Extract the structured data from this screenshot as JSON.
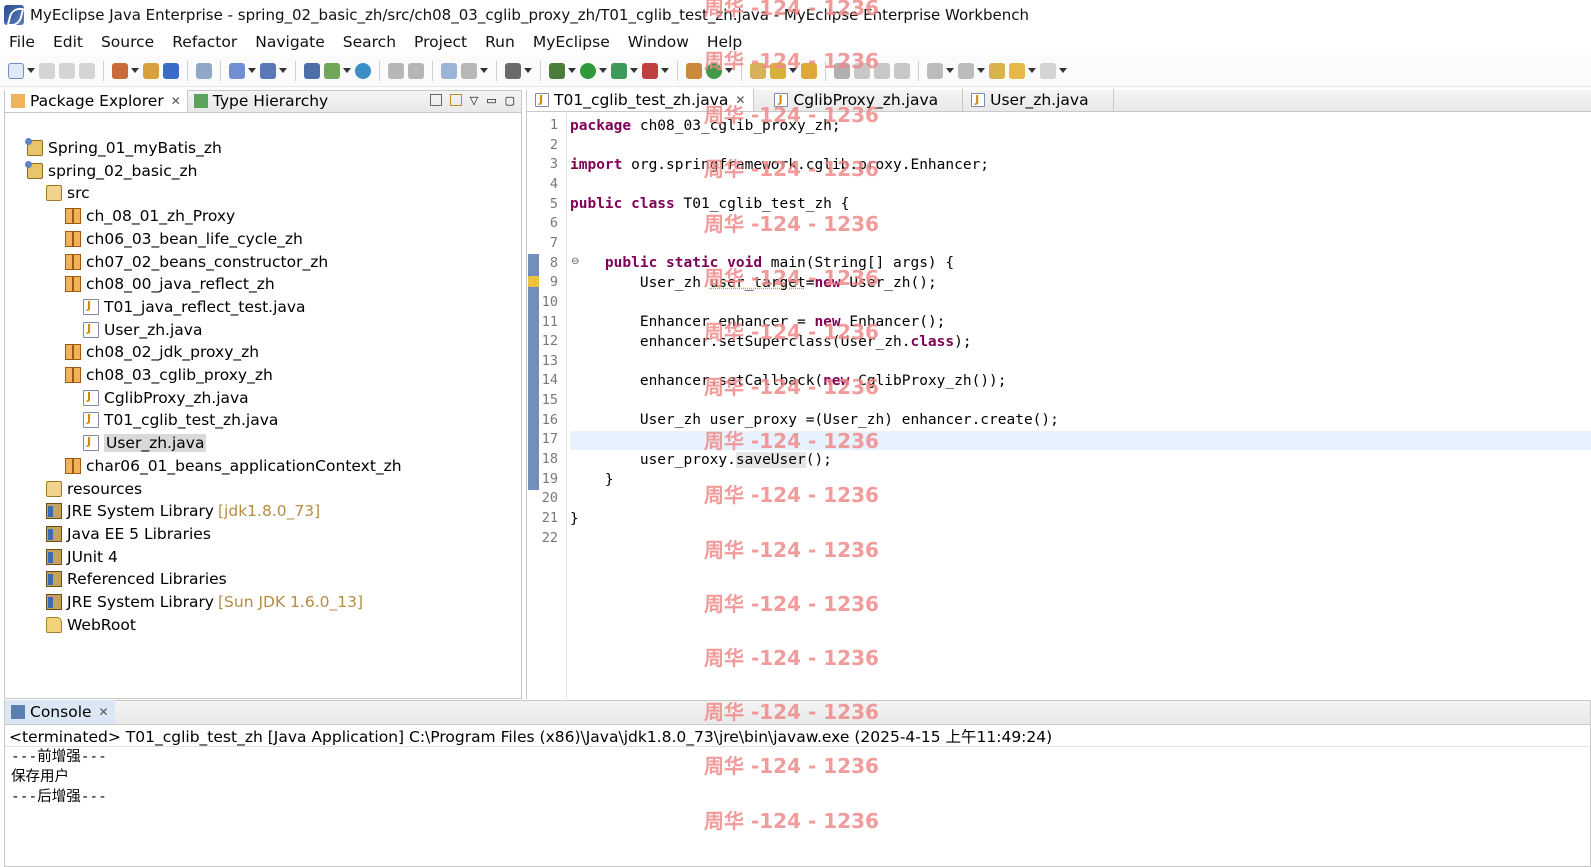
{
  "window": {
    "title": "MyEclipse Java Enterprise - spring_02_basic_zh/src/ch08_03_cglib_proxy_zh/T01_cglib_test_zh.java - MyEclipse Enterprise Workbench"
  },
  "menubar": [
    "File",
    "Edit",
    "Source",
    "Refactor",
    "Navigate",
    "Search",
    "Project",
    "Run",
    "MyEclipse",
    "Window",
    "Help"
  ],
  "left_panel": {
    "tabs": [
      {
        "label": "Package Explorer",
        "active": true
      },
      {
        "label": "Type Hierarchy",
        "active": false
      }
    ],
    "tree": [
      {
        "label": "Spring_01_myBatis_zh",
        "icon": "project-icon",
        "indent": 0
      },
      {
        "label": "spring_02_basic_zh",
        "icon": "project-icon",
        "indent": 0
      },
      {
        "label": "src",
        "icon": "source-folder-icon",
        "indent": 1
      },
      {
        "label": "ch_08_01_zh_Proxy",
        "icon": "package-icon",
        "indent": 2
      },
      {
        "label": "ch06_03_bean_life_cycle_zh",
        "icon": "package-icon",
        "indent": 2
      },
      {
        "label": "ch07_02_beans_constructor_zh",
        "icon": "package-icon",
        "indent": 2
      },
      {
        "label": "ch08_00_java_reflect_zh",
        "icon": "package-icon",
        "indent": 2
      },
      {
        "label": "T01_java_reflect_test.java",
        "icon": "java-file-icon",
        "indent": 3
      },
      {
        "label": "User_zh.java",
        "icon": "java-file-icon",
        "indent": 3
      },
      {
        "label": "ch08_02_jdk_proxy_zh",
        "icon": "package-icon",
        "indent": 2
      },
      {
        "label": "ch08_03_cglib_proxy_zh",
        "icon": "package-icon",
        "indent": 2
      },
      {
        "label": "CglibProxy_zh.java",
        "icon": "java-file-icon",
        "indent": 3
      },
      {
        "label": "T01_cglib_test_zh.java",
        "icon": "java-file-icon",
        "indent": 3
      },
      {
        "label": "User_zh.java",
        "icon": "java-file-icon",
        "indent": 3,
        "selected": true
      },
      {
        "label": "char06_01_beans_applicationContext_zh",
        "icon": "package-icon",
        "indent": 2
      },
      {
        "label": "resources",
        "icon": "source-folder-icon",
        "indent": 1
      },
      {
        "label": "JRE System Library",
        "version": "[jdk1.8.0_73]",
        "icon": "library-icon",
        "indent": 1
      },
      {
        "label": "Java EE 5 Libraries",
        "icon": "library-icon",
        "indent": 1
      },
      {
        "label": "JUnit 4",
        "icon": "library-icon",
        "indent": 1
      },
      {
        "label": "Referenced Libraries",
        "icon": "library-icon",
        "indent": 1
      },
      {
        "label": "JRE System Library",
        "version": "[Sun JDK 1.6.0_13]",
        "icon": "library-icon",
        "indent": 1
      },
      {
        "label": "WebRoot",
        "icon": "folder-icon",
        "indent": 1
      }
    ]
  },
  "editor": {
    "tabs": [
      {
        "label": "T01_cglib_test_zh.java",
        "active": true
      },
      {
        "label": "CglibProxy_zh.java",
        "active": false
      },
      {
        "label": "User_zh.java",
        "active": false
      }
    ],
    "line_numbers": [
      "1",
      "2",
      "3",
      "4",
      "5",
      "6",
      "7",
      "8",
      "9",
      "10",
      "11",
      "12",
      "13",
      "14",
      "15",
      "16",
      "17",
      "18",
      "19",
      "20",
      "21",
      "22"
    ],
    "code": {
      "l1_kw": "package",
      "l1_rest": " ch08_03_cglib_proxy_zh;",
      "l3_kw": "import",
      "l3_rest": " org.springframework.cglib.proxy.Enhancer;",
      "l5_kw": "public class",
      "l5_rest": " T01_cglib_test_zh {",
      "l8_indent": "    ",
      "l8_kw": "public static void",
      "l8_rest": " main(String[] args) {",
      "l9_a": "        User_zh ",
      "l9_warn": "user_target",
      "l9_b": "=",
      "l9_kw": "new",
      "l9_c": " User_zh();",
      "l11_a": "        Enhancer enhancer = ",
      "l11_kw": "new",
      "l11_b": " Enhancer();",
      "l12_a": "        enhancer.setSuperclass(User_zh.",
      "l12_kw": "class",
      "l12_b": ");",
      "l14_a": "        enhancer.setCallback(",
      "l14_kw": "new",
      "l14_b": " CglibProxy_zh());",
      "l16": "        User_zh user_proxy =(User_zh) enhancer.create();",
      "l18_a": "        user_proxy.",
      "l18_hl": "saveUser",
      "l18_b": "();",
      "l19": "    }",
      "l21": "}"
    }
  },
  "console": {
    "tab_label": "Console",
    "description": "<terminated> T01_cglib_test_zh [Java Application] C:\\Program Files (x86)\\Java\\jdk1.8.0_73\\jre\\bin\\javaw.exe (2025-4-15 上午11:49:24)",
    "output": [
      "---前增强---",
      "保存用户",
      "---后增强---"
    ]
  },
  "watermark": "周华 -124 - 1236",
  "colors": {
    "keyword": "#7f0055",
    "current_line": "#e8f2fe",
    "watermark": "#f08a8a",
    "library_version": "#b58c43"
  }
}
